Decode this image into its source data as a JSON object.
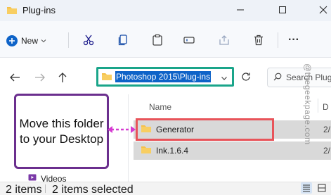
{
  "window": {
    "title": "Plug-ins"
  },
  "toolbar": {
    "new_label": "New",
    "more_label": "···"
  },
  "address": {
    "path": "Photoshop 2015\\Plug-ins"
  },
  "search": {
    "placeholder": "Search Plug"
  },
  "columns": {
    "name": "Name",
    "date": "D"
  },
  "files": [
    {
      "name": "Generator",
      "date": "2/"
    },
    {
      "name": "Ink.1.6.4",
      "date": "2/"
    }
  ],
  "sidebar": {
    "videos_label": "Videos"
  },
  "callout": {
    "text": "Move this folder to your Desktop"
  },
  "status": {
    "items": "2 items",
    "selected": "2 items selected"
  },
  "watermark": {
    "text": "@thegeekpage.com"
  },
  "colors": {
    "address_border": "#1aa58a",
    "highlight_border": "#e8545a",
    "callout_border": "#6b2f8e",
    "arrow": "#d63bd1",
    "folder": "#f5c04a"
  }
}
